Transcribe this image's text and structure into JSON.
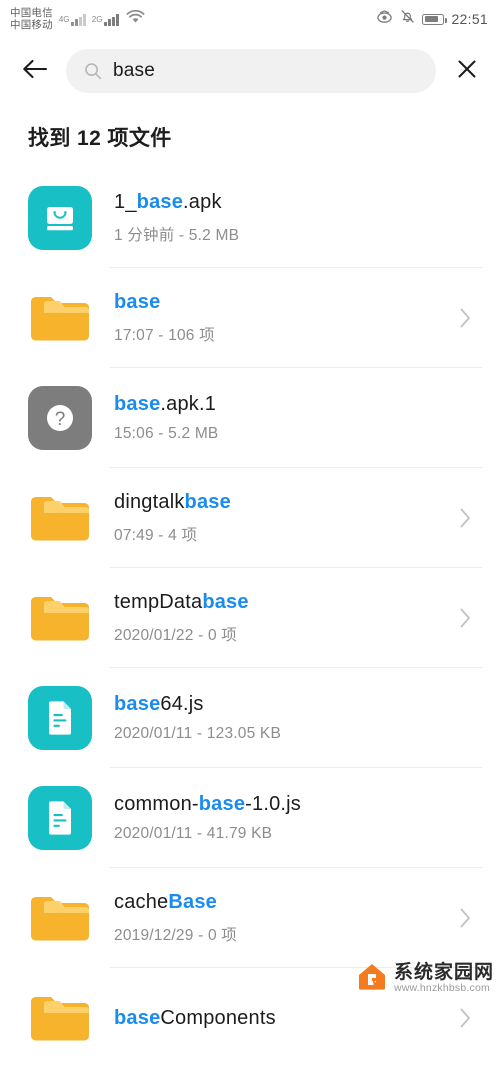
{
  "statusbar": {
    "carrier_primary": "中国电信",
    "carrier_secondary": "中国移动",
    "network_primary": "4G",
    "network_secondary": "2G",
    "wifi_icon": "wifi-icon",
    "eye_comfort_icon": "eye-comfort-icon",
    "mute_icon": "bell-mute-icon",
    "battery_icon": "battery-icon",
    "time": "22:51"
  },
  "searchbar": {
    "back_icon": "arrow-left-icon",
    "search_icon": "search-icon",
    "query": "base",
    "placeholder": "base",
    "clear_icon": "close-icon"
  },
  "results": {
    "heading": "找到 12 项文件",
    "count": 12,
    "highlight_color": "#1a8cf0",
    "items": [
      {
        "icon": "apk-icon",
        "icon_type": "apk",
        "name_prefix": "1_",
        "name_highlight": "base",
        "name_suffix": ".apk",
        "subtitle": "1 分钟前 - 5.2 MB",
        "chevron": false
      },
      {
        "icon": "folder-icon",
        "icon_type": "folder",
        "name_prefix": "",
        "name_highlight": "base",
        "name_suffix": "",
        "subtitle": "17:07 - 106 项",
        "chevron": true
      },
      {
        "icon": "unknown-file-icon",
        "icon_type": "unknown",
        "name_prefix": "",
        "name_highlight": "base",
        "name_suffix": ".apk.1",
        "subtitle": "15:06 - 5.2 MB",
        "chevron": false
      },
      {
        "icon": "folder-icon",
        "icon_type": "folder",
        "name_prefix": "dingtalk",
        "name_highlight": "base",
        "name_suffix": "",
        "subtitle": "07:49 - 4 项",
        "chevron": true
      },
      {
        "icon": "folder-icon",
        "icon_type": "folder",
        "name_prefix": "tempData",
        "name_highlight": "base",
        "name_suffix": "",
        "subtitle": "2020/01/22 - 0 项",
        "chevron": true
      },
      {
        "icon": "js-file-icon",
        "icon_type": "doc",
        "name_prefix": "",
        "name_highlight": "base",
        "name_suffix": "64.js",
        "subtitle": "2020/01/11 - 123.05 KB",
        "chevron": false
      },
      {
        "icon": "js-file-icon",
        "icon_type": "doc",
        "name_prefix": "common-",
        "name_highlight": "base",
        "name_suffix": "-1.0.js",
        "subtitle": "2020/01/11 - 41.79 KB",
        "chevron": false
      },
      {
        "icon": "folder-icon",
        "icon_type": "folder",
        "name_prefix": "cache",
        "name_highlight": "Base",
        "name_suffix": "",
        "subtitle": "2019/12/29 - 0 项",
        "chevron": true
      },
      {
        "icon": "folder-icon",
        "icon_type": "folder",
        "name_prefix": "",
        "name_highlight": "base",
        "name_suffix": "Components",
        "subtitle": "",
        "chevron": true
      }
    ]
  },
  "watermark": {
    "logo_icon": "house-logo-icon",
    "site_name": "系统家园网",
    "site_url": "www.hnzkhbsb.com"
  }
}
